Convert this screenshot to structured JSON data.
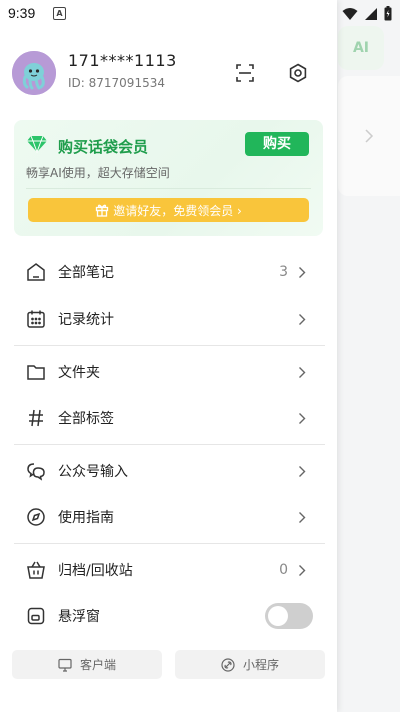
{
  "status_bar": {
    "time": "9:39",
    "notification_letter": "A"
  },
  "background": {
    "ai_label": "AI"
  },
  "profile": {
    "name": "171****1113",
    "id_text": "ID: 8717091534"
  },
  "vip": {
    "title": "购买话袋会员",
    "buy_label": "购买",
    "subtitle": "畅享AI使用，超大存储空间",
    "invite_label": "邀请好友，免费领会员 ›"
  },
  "menu": {
    "all_notes": {
      "label": "全部笔记",
      "count": "3"
    },
    "stats": {
      "label": "记录统计"
    },
    "folder": {
      "label": "文件夹"
    },
    "tags": {
      "label": "全部标签"
    },
    "wechat_input": {
      "label": "公众号输入"
    },
    "guide": {
      "label": "使用指南"
    },
    "archive": {
      "label": "归档/回收站",
      "count": "0"
    },
    "floating": {
      "label": "悬浮窗",
      "enabled": false
    }
  },
  "footer": {
    "client_label": "客户端",
    "miniapp_label": "小程序"
  },
  "colors": {
    "accent_green": "#21b65a",
    "vip_title": "#1f9d4c",
    "invite_yellow": "#f9c53b"
  },
  "icons": {
    "scan": "scan-icon",
    "settings": "settings-icon",
    "gem": "diamond-icon",
    "gift": "gift-icon",
    "notes": "note-icon",
    "calendar": "calendar-icon",
    "folder": "folder-icon",
    "hash": "hashtag-icon",
    "chat": "chat-icon",
    "compass": "compass-icon",
    "basket": "archive-icon",
    "window": "floating-window-icon",
    "monitor": "monitor-icon",
    "link": "link-icon"
  }
}
